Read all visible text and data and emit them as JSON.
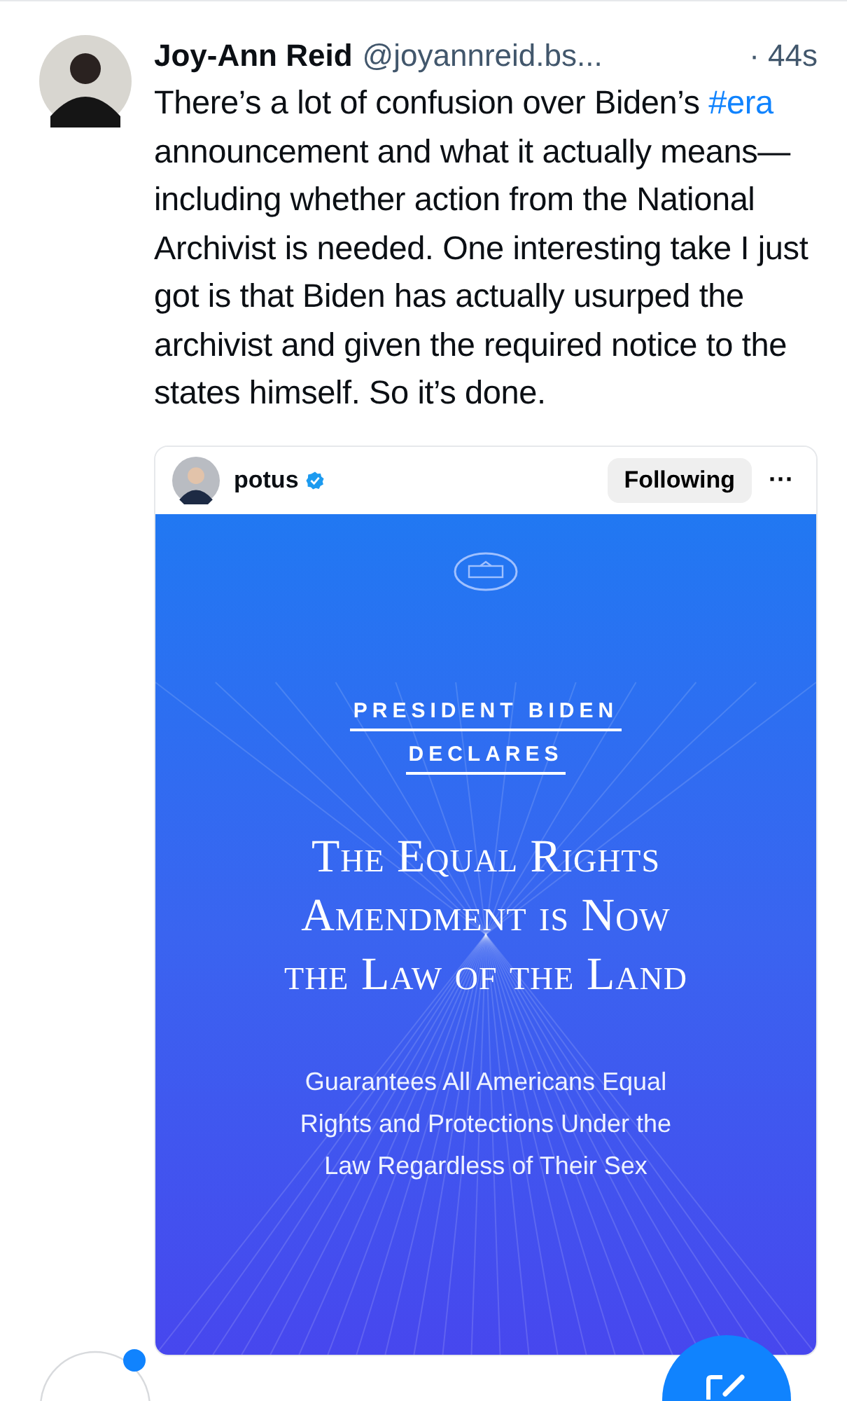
{
  "post": {
    "author": "Joy-Ann Reid",
    "handle": "@joyannreid.bs...",
    "time": "· 44s",
    "body": [
      {
        "kind": "text",
        "text": "There’s a lot of confusion over Biden’s "
      },
      {
        "kind": "hashtag",
        "text": "#era"
      },
      {
        "kind": "text",
        "text": " announcement and what it actually means—including whether action from the National Archivist is needed. One interesting take I just got is that Biden has actually usurped the archivist and given the required notice to the states himself. So it’s done."
      }
    ]
  },
  "embed": {
    "account": "potus",
    "verified": true,
    "follow_button": "Following",
    "more": "···",
    "graphic": {
      "kicker": [
        "PRESIDENT BIDEN",
        "DECLARES"
      ],
      "headline": [
        "The Equal Rights",
        "Amendment is Now",
        "the Law of the Land"
      ],
      "subtitle": [
        "Guarantees All Americans Equal",
        "Rights and Protections Under the",
        "Law Regardless of Their Sex"
      ]
    }
  },
  "bottom": {
    "notification_dot": true
  }
}
